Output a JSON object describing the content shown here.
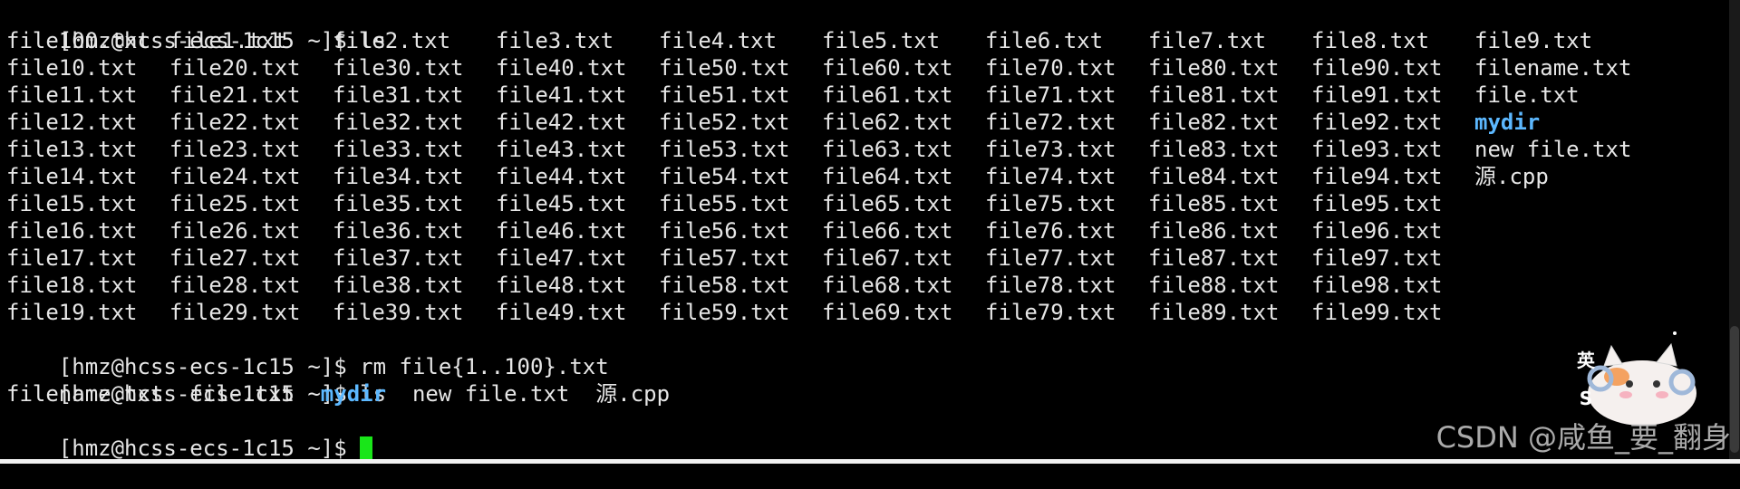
{
  "terminal": {
    "prompt": "[hmz@hcss-ecs-1c15 ~]$ ",
    "commands": {
      "first": "ls",
      "second": "rm file{1..100}.txt",
      "third": "ls"
    },
    "listing": [
      [
        "file100.txt",
        "file1.txt",
        "file2.txt",
        "file3.txt",
        "file4.txt",
        "file5.txt",
        "file6.txt",
        "file7.txt",
        "file8.txt",
        "file9.txt"
      ],
      [
        "file10.txt",
        "file20.txt",
        "file30.txt",
        "file40.txt",
        "file50.txt",
        "file60.txt",
        "file70.txt",
        "file80.txt",
        "file90.txt",
        "filename.txt"
      ],
      [
        "file11.txt",
        "file21.txt",
        "file31.txt",
        "file41.txt",
        "file51.txt",
        "file61.txt",
        "file71.txt",
        "file81.txt",
        "file91.txt",
        "file.txt"
      ],
      [
        "file12.txt",
        "file22.txt",
        "file32.txt",
        "file42.txt",
        "file52.txt",
        "file62.txt",
        "file72.txt",
        "file82.txt",
        "file92.txt",
        "mydir"
      ],
      [
        "file13.txt",
        "file23.txt",
        "file33.txt",
        "file43.txt",
        "file53.txt",
        "file63.txt",
        "file73.txt",
        "file83.txt",
        "file93.txt",
        "new file.txt"
      ],
      [
        "file14.txt",
        "file24.txt",
        "file34.txt",
        "file44.txt",
        "file54.txt",
        "file64.txt",
        "file74.txt",
        "file84.txt",
        "file94.txt",
        "源.cpp"
      ],
      [
        "file15.txt",
        "file25.txt",
        "file35.txt",
        "file45.txt",
        "file55.txt",
        "file65.txt",
        "file75.txt",
        "file85.txt",
        "file95.txt",
        ""
      ],
      [
        "file16.txt",
        "file26.txt",
        "file36.txt",
        "file46.txt",
        "file56.txt",
        "file66.txt",
        "file76.txt",
        "file86.txt",
        "file96.txt",
        ""
      ],
      [
        "file17.txt",
        "file27.txt",
        "file37.txt",
        "file47.txt",
        "file57.txt",
        "file67.txt",
        "file77.txt",
        "file87.txt",
        "file97.txt",
        ""
      ],
      [
        "file18.txt",
        "file28.txt",
        "file38.txt",
        "file48.txt",
        "file58.txt",
        "file68.txt",
        "file78.txt",
        "file88.txt",
        "file98.txt",
        ""
      ],
      [
        "file19.txt",
        "file29.txt",
        "file39.txt",
        "file49.txt",
        "file59.txt",
        "file69.txt",
        "file79.txt",
        "file89.txt",
        "file99.txt",
        ""
      ]
    ],
    "directory_names": [
      "mydir"
    ],
    "second_listing": [
      "filename.txt",
      "file.txt",
      "mydir",
      "new file.txt",
      "源.cpp"
    ]
  },
  "colors": {
    "background": "#000000",
    "text": "#e6e6e6",
    "directory": "#5cb8ff",
    "cursor": "#19e619"
  },
  "watermark": {
    "text": "CSDN @咸鱼_要_翻身"
  },
  "sticker": {
    "text_top": "英",
    "text_bottom": "S"
  }
}
